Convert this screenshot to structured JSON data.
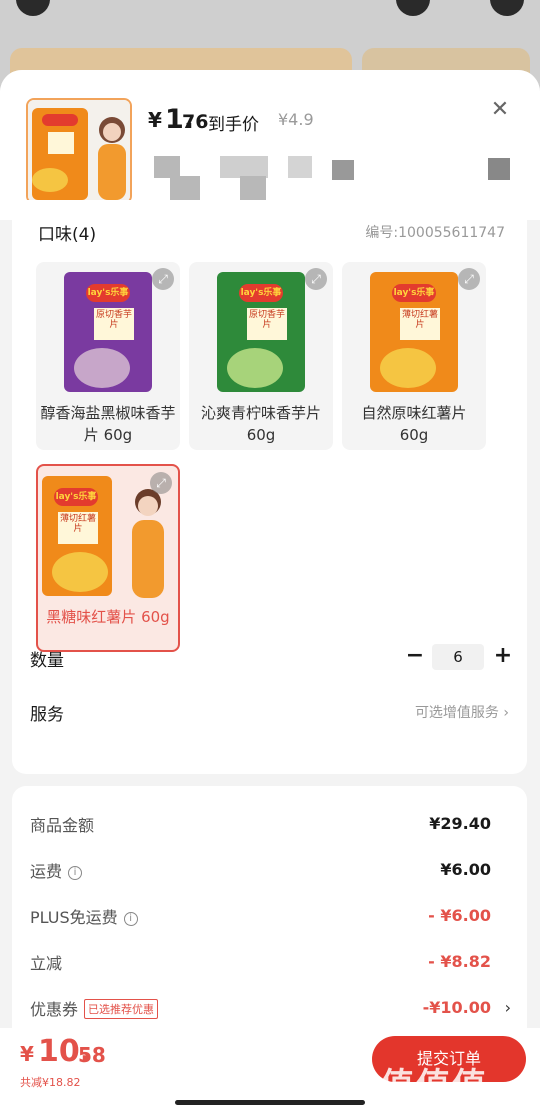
{
  "header": {
    "price_currency": "¥",
    "price_int": "1.",
    "price_dec": "76",
    "price_tag": "到手价",
    "original_price": "¥4.9",
    "close_icon": "close-icon"
  },
  "flavor": {
    "title": "口味(4)",
    "sku": "编号:100055611747",
    "options": [
      {
        "label": "醇香海盐黑椒味香芋片 60g",
        "color": "#7a3aa0"
      },
      {
        "label": "沁爽青柠味香芋片 60g",
        "color": "#2e8a3a"
      },
      {
        "label": "自然原味红薯片 60g",
        "color": "#f08a1a"
      },
      {
        "label": "黑糖味红薯片 60g",
        "color": "#f08a1a"
      }
    ],
    "bag_logo": "lay's乐事",
    "bag_texts": [
      "原切香芋片",
      "原切香芋片",
      "薄切红薯片",
      "薄切红薯片"
    ]
  },
  "quantity": {
    "label": "数量",
    "minus": "−",
    "value": "6",
    "plus": "+"
  },
  "service": {
    "label": "服务",
    "link": "可选增值服务 ›"
  },
  "summary": {
    "rows": [
      {
        "label": "商品金额",
        "value": "¥29.40"
      },
      {
        "label": "运费",
        "value": "¥6.00"
      },
      {
        "label": "PLUS免运费",
        "value": "- ¥6.00"
      },
      {
        "label": "立减",
        "value": "- ¥8.82"
      },
      {
        "label": "优惠券",
        "tag": "已选推荐优惠",
        "value": "-¥10.00"
      }
    ]
  },
  "footer": {
    "currency": "¥",
    "total_int": "10.",
    "total_dec": "58",
    "saved": "共减¥18.82",
    "submit": "提交订单"
  },
  "watermark": {
    "text": "值值值",
    "url": "zhizhizhi.com"
  }
}
